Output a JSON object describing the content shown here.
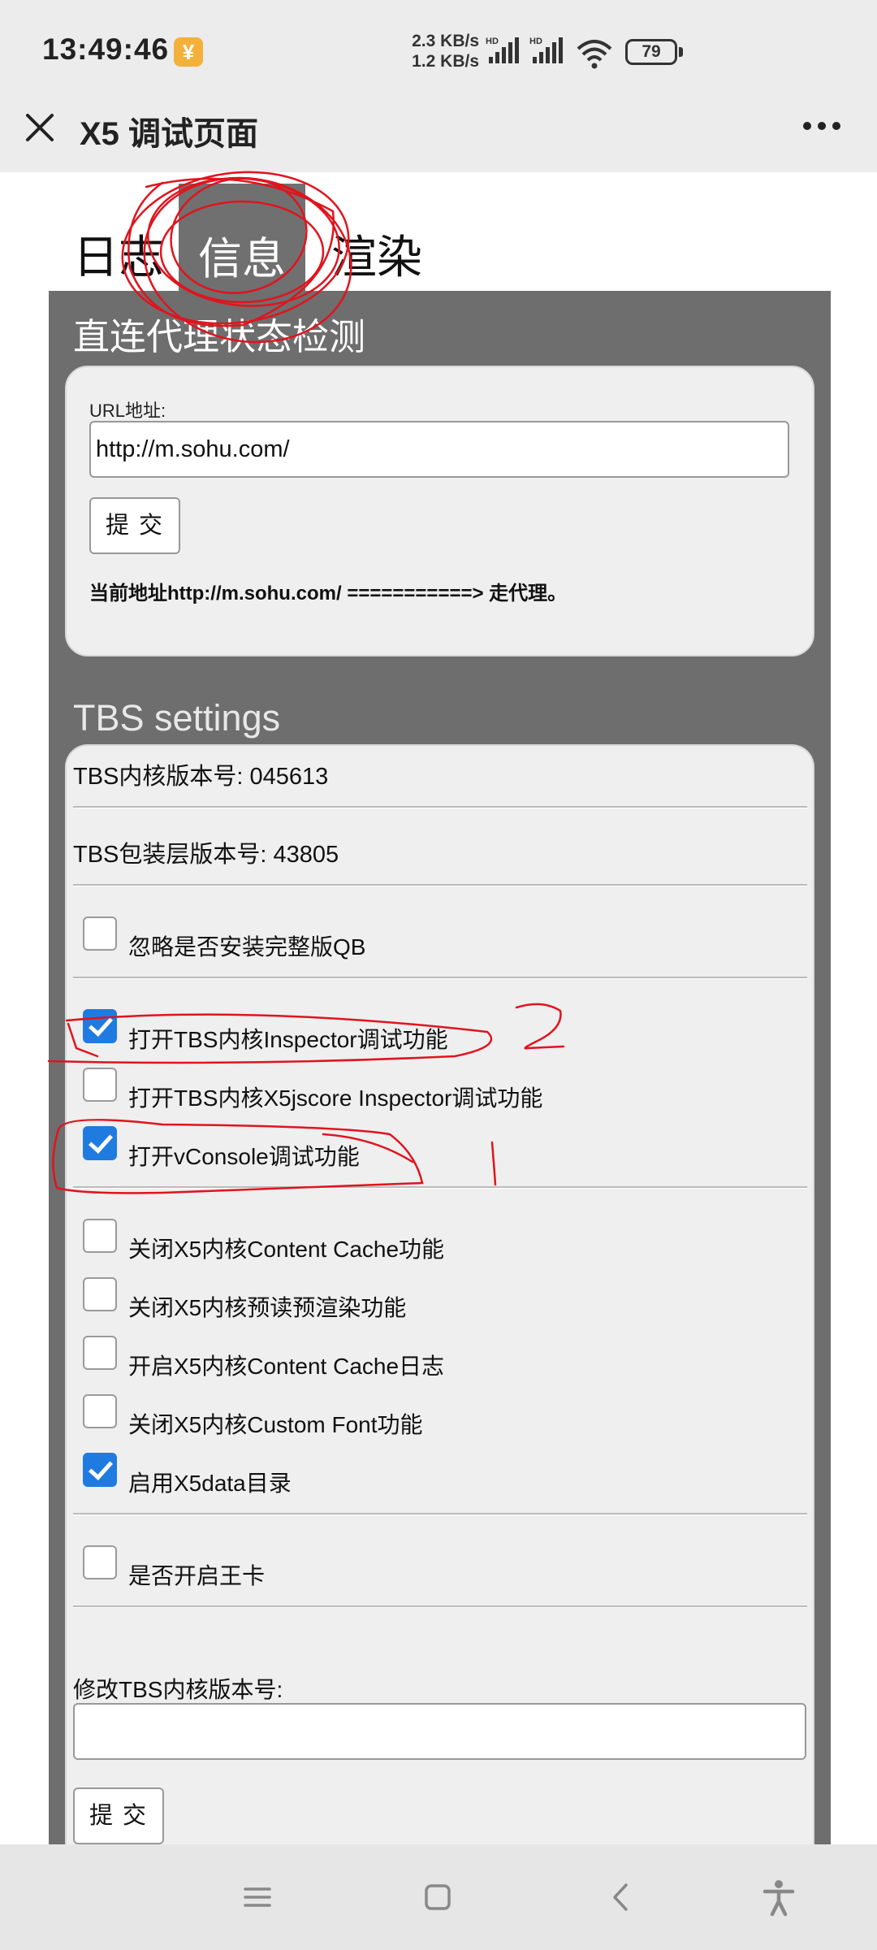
{
  "status_bar": {
    "time": "13:49:46",
    "notification_icon": "yen-notification-icon",
    "net_up": "2.3 KB/s",
    "net_down": "1.2 KB/s",
    "hd1": "HD",
    "hd2": "HD",
    "battery": "79"
  },
  "title_bar": {
    "title": "X5 调试页面"
  },
  "tabs": [
    {
      "label": "日志"
    },
    {
      "label": "信息"
    },
    {
      "label": "渲染"
    }
  ],
  "proxy_section": {
    "title": "直连代理状态检测",
    "url_label": "URL地址:",
    "url_value": "http://m.sohu.com/",
    "submit_label": "提交",
    "status_text": "当前地址http://m.sohu.com/ ===========> 走代理。"
  },
  "tbs_section": {
    "title": "TBS settings",
    "core_version": "TBS内核版本号: 045613",
    "wrapper_version": "TBS包装层版本号: 43805",
    "options": [
      {
        "label": "忽略是否安装完整版QB",
        "checked": false
      },
      {
        "label": "打开TBS内核Inspector调试功能",
        "checked": true
      },
      {
        "label": "打开TBS内核X5jscore Inspector调试功能",
        "checked": false
      },
      {
        "label": "打开vConsole调试功能",
        "checked": true
      },
      {
        "label": "关闭X5内核Content Cache功能",
        "checked": false
      },
      {
        "label": "关闭X5内核预读预渲染功能",
        "checked": false
      },
      {
        "label": "开启X5内核Content Cache日志",
        "checked": false
      },
      {
        "label": "关闭X5内核Custom Font功能",
        "checked": false
      },
      {
        "label": "启用X5data目录",
        "checked": true
      },
      {
        "label": "是否开启王卡",
        "checked": false
      }
    ],
    "edit_label": "修改TBS内核版本号:",
    "edit_value": "",
    "submit_label": "提交"
  },
  "annotations": {
    "mark_2": "2",
    "mark_1": "1",
    "color": "#e0141e"
  },
  "colors": {
    "panel": "#6e6e6e",
    "checkbox_checked": "#1f7be0",
    "card_bg": "#efefef"
  }
}
